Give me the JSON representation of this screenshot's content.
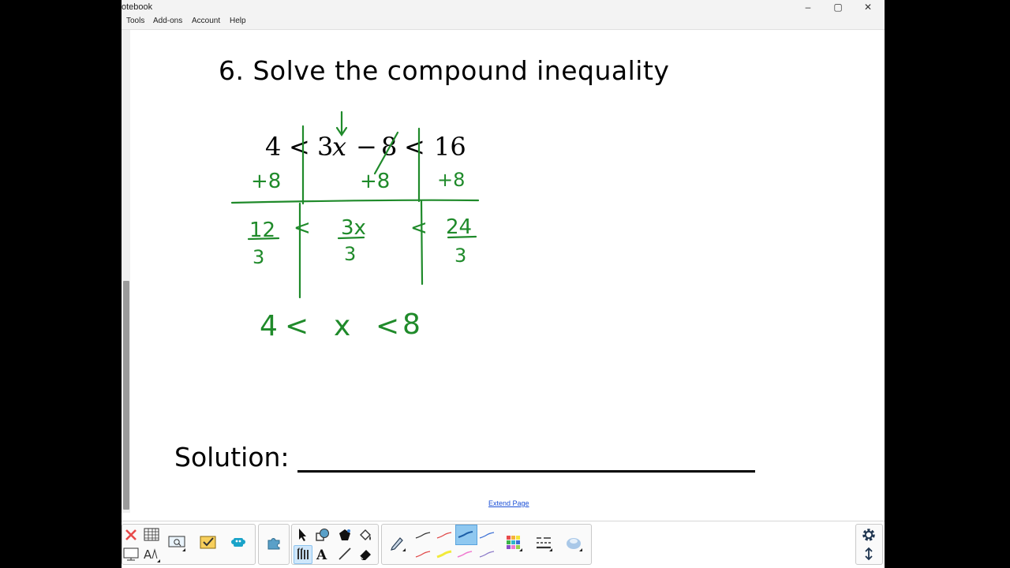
{
  "window": {
    "title": "otebook",
    "minimize_glyph": "–",
    "maximize_glyph": "▢",
    "close_glyph": "✕"
  },
  "menu": {
    "items": [
      "Tools",
      "Add-ons",
      "Account",
      "Help"
    ]
  },
  "page": {
    "problem": "6.  Solve the compound inequality",
    "solution_label": "Solution:",
    "extend_link": "Extend Page"
  },
  "equation": {
    "parts": [
      "4",
      "<",
      "3",
      "x",
      "−",
      "8",
      "<",
      "16"
    ]
  },
  "ink": {
    "color": "#1f8a2a",
    "step1": [
      "+8",
      "+8",
      "+8"
    ],
    "step2_numerators": [
      "12",
      "3x",
      "24"
    ],
    "step2_denominators": [
      "3",
      "3",
      "3"
    ],
    "step2_signs": [
      "<",
      "<"
    ],
    "result": [
      "4",
      "<",
      "x",
      "<",
      "8"
    ]
  },
  "toolbar": {
    "accent": "#4a9ee0",
    "groups": [
      {
        "name": "page-tools",
        "icons": [
          "delete-icon",
          "table-icon",
          "screen-capture-icon",
          "check-activity-icon",
          "lab-tools-icon",
          "display-icon",
          "text-recognition-icon"
        ]
      },
      {
        "name": "add-ons",
        "icons": [
          "addons-icon"
        ]
      },
      {
        "name": "select-tools",
        "icons": [
          "select-icon",
          "shapes-icon",
          "polygon-icon",
          "fill-icon",
          "pens-icon",
          "text-icon",
          "line-icon",
          "eraser-icon"
        ]
      },
      {
        "name": "pen-properties",
        "icons": [
          "pen-icon",
          "pen-swatch-black",
          "pen-swatch-red",
          "pen-swatch-blue-selected",
          "pen-swatch-blue",
          "pen-swatch-red-2",
          "pen-swatch-yellow",
          "pen-swatch-pink",
          "pen-swatch-purple",
          "color-palette-icon",
          "line-style-icon",
          "fill-effects-icon"
        ]
      },
      {
        "name": "settings",
        "icons": [
          "gear-icon",
          "move-toolbar-icon"
        ]
      }
    ]
  }
}
